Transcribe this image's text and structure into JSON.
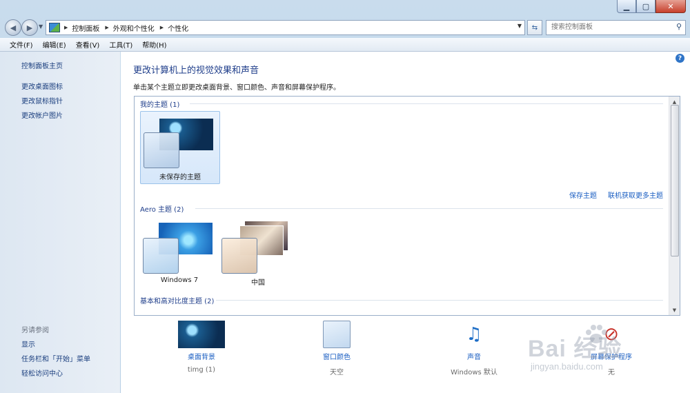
{
  "window": {
    "controls": [
      "▁",
      "▢",
      "✕"
    ]
  },
  "navbar": {
    "breadcrumbs": [
      "控制面板",
      "外观和个性化",
      "个性化"
    ],
    "search_placeholder": "搜索控制面板"
  },
  "menubar": {
    "items": [
      "文件(F)",
      "编辑(E)",
      "查看(V)",
      "工具(T)",
      "帮助(H)"
    ]
  },
  "sidebar": {
    "home": "控制面板主页",
    "links": [
      "更改桌面图标",
      "更改鼠标指针",
      "更改帐户图片"
    ],
    "see_also_title": "另请参阅",
    "see_also": [
      "显示",
      "任务栏和「开始」菜单",
      "轻松访问中心"
    ]
  },
  "main": {
    "help": "?",
    "heading": "更改计算机上的视觉效果和声音",
    "subtitle": "单击某个主题立即更改桌面背景、窗口颜色、声音和屏幕保护程序。",
    "groups": {
      "my_themes": "我的主题 (1)",
      "aero_themes": "Aero 主题 (2)",
      "basic_themes": "基本和高对比度主题 (2)"
    },
    "themes": {
      "unsaved": "未保存的主题",
      "win7": "Windows 7",
      "china": "中国"
    },
    "theme_links": [
      "保存主题",
      "联机获取更多主题"
    ]
  },
  "bottom": {
    "items": [
      {
        "label": "桌面背景",
        "sub": "timg (1)"
      },
      {
        "label": "窗口颜色",
        "sub": "天空"
      },
      {
        "label": "声音",
        "sub": "Windows 默认"
      },
      {
        "label": "屏幕保护程序",
        "sub": "无"
      }
    ]
  },
  "watermark": {
    "brand": "Bai  经验",
    "site": "jingyan.baidu.com"
  },
  "colors": {
    "link": "#1a5ec2",
    "heading": "#1e3d8a",
    "selection": "#d6e7fa"
  }
}
